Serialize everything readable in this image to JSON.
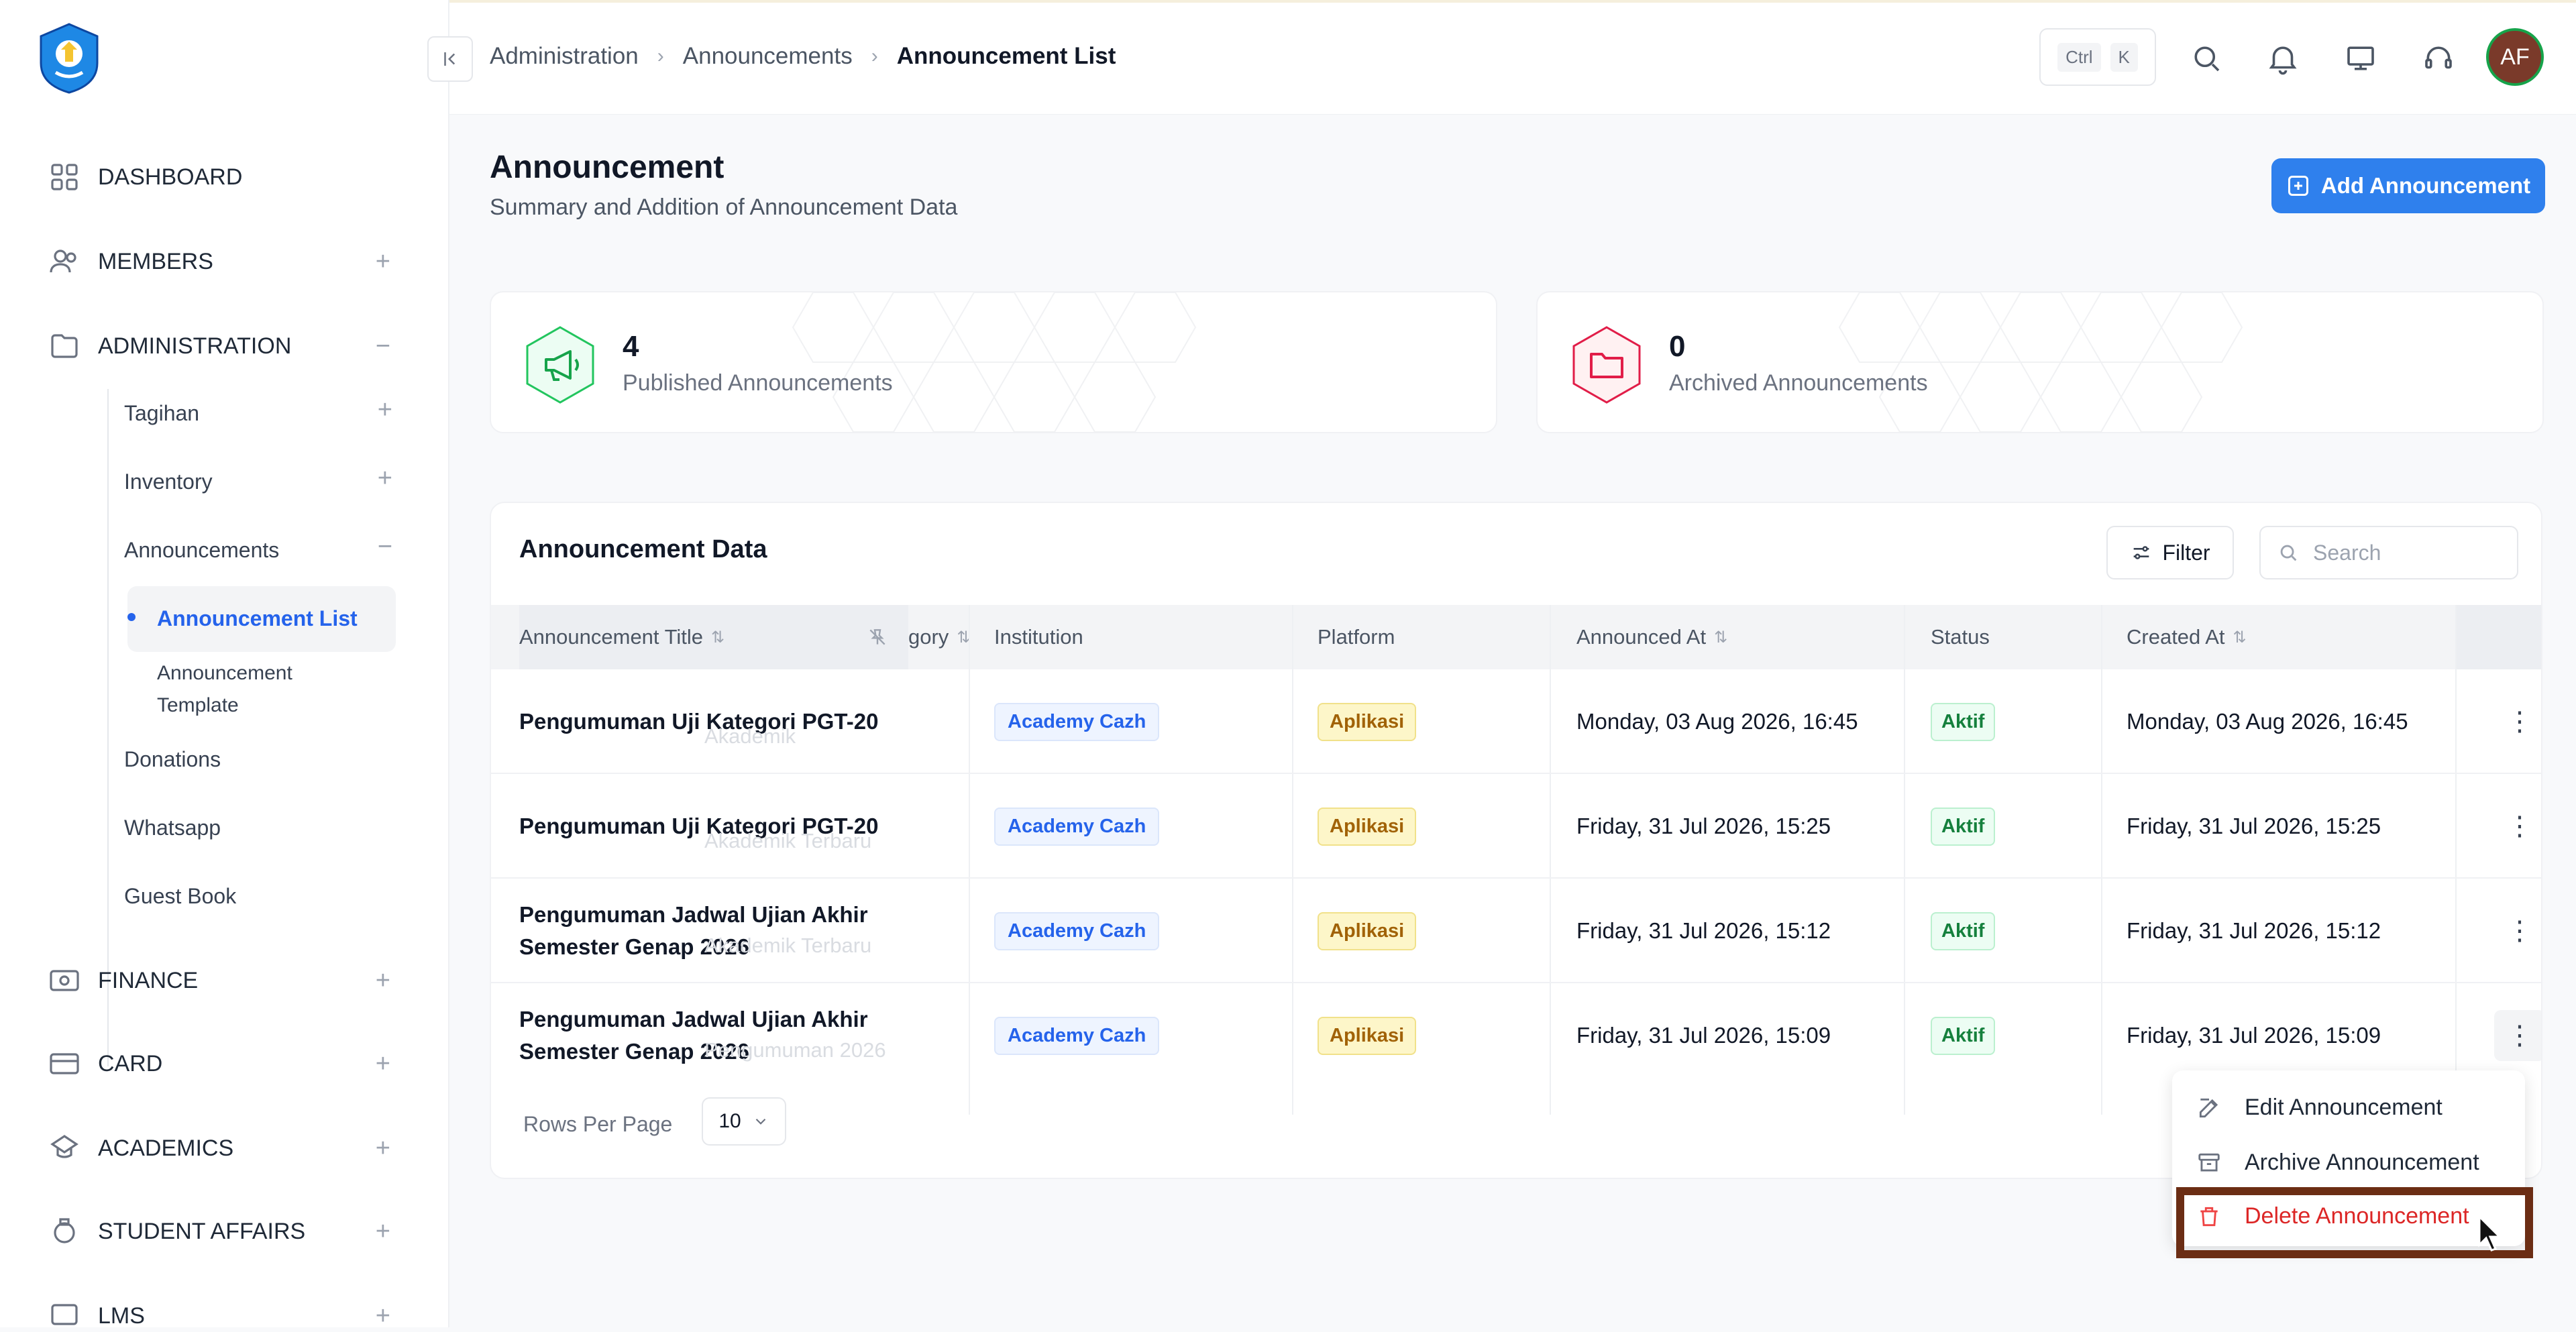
{
  "sidebar": {
    "items": [
      {
        "label": "DASHBOARD",
        "icon": "grid-icon",
        "toggle": ""
      },
      {
        "label": "MEMBERS",
        "icon": "users-icon",
        "toggle": "+"
      },
      {
        "label": "ADMINISTRATION",
        "icon": "folder-icon",
        "toggle": "−"
      },
      {
        "label": "FINANCE",
        "icon": "cash-icon",
        "toggle": "+"
      },
      {
        "label": "CARD",
        "icon": "card-icon",
        "toggle": "+"
      },
      {
        "label": "ACADEMICS",
        "icon": "academics-icon",
        "toggle": "+"
      },
      {
        "label": "STUDENT AFFAIRS",
        "icon": "badge-icon",
        "toggle": "+"
      },
      {
        "label": "LMS",
        "icon": "lms-icon",
        "toggle": "+"
      }
    ],
    "admin_sub": [
      {
        "label": "Tagihan",
        "toggle": "+"
      },
      {
        "label": "Inventory",
        "toggle": "+"
      },
      {
        "label": "Announcements",
        "toggle": "−"
      },
      {
        "label": "Donations",
        "toggle": ""
      },
      {
        "label": "Whatsapp",
        "toggle": ""
      },
      {
        "label": "Guest Book",
        "toggle": ""
      }
    ],
    "ann_sub": [
      {
        "label": "Announcement List",
        "active": true
      },
      {
        "label": "Announcement Template",
        "active": false
      }
    ]
  },
  "header": {
    "breadcrumb": [
      "Administration",
      "Announcements",
      "Announcement List"
    ],
    "kbd": [
      "Ctrl",
      "K"
    ],
    "avatar": "AF"
  },
  "page": {
    "title": "Announcement",
    "subtitle": "Summary and Addition of Announcement Data",
    "add_button": "Add Announcement"
  },
  "stats": [
    {
      "value": "4",
      "label": "Published Announcements",
      "color": "#22c55e"
    },
    {
      "value": "0",
      "label": "Archived Announcements",
      "color": "#e11d48"
    }
  ],
  "table": {
    "heading": "Announcement Data",
    "filter_label": "Filter",
    "search_placeholder": "Search",
    "columns": [
      "Announcement Title",
      "Institution",
      "Platform",
      "Announced At",
      "Status",
      "Created At"
    ],
    "ghost_header": "gory",
    "rows": [
      {
        "title": "Pengumuman Uji Kategori PGT-20",
        "ghost": "Akademik",
        "institution": "Academy Cazh",
        "platform": "Aplikasi",
        "announced": "Monday, 03 Aug 2026, 16:45",
        "status": "Aktif",
        "created": "Monday, 03 Aug 2026, 16:45"
      },
      {
        "title": "Pengumuman Uji Kategori PGT-20",
        "ghost": "Akademik Terbaru",
        "institution": "Academy Cazh",
        "platform": "Aplikasi",
        "announced": "Friday, 31 Jul 2026, 15:25",
        "status": "Aktif",
        "created": "Friday, 31 Jul 2026, 15:25"
      },
      {
        "title": "Pengumuman Jadwal Ujian Akhir Semester Genap 2026",
        "ghost": "Akademik Terbaru",
        "institution": "Academy Cazh",
        "platform": "Aplikasi",
        "announced": "Friday, 31 Jul 2026, 15:12",
        "status": "Aktif",
        "created": "Friday, 31 Jul 2026, 15:12"
      },
      {
        "title": "Pengumuman Jadwal Ujian Akhir Semester Genap 2026",
        "ghost": "Pengumuman 2026",
        "institution": "Academy Cazh",
        "platform": "Aplikasi",
        "announced": "Friday, 31 Jul 2026, 15:09",
        "status": "Aktif",
        "created": "Friday, 31 Jul 2026, 15:09"
      }
    ],
    "rows_per_page_label": "Rows Per Page",
    "rows_per_page_value": "10"
  },
  "context_menu": {
    "items": [
      {
        "label": "Edit Announcement",
        "icon": "edit-icon"
      },
      {
        "label": "Archive Announcement",
        "icon": "archive-icon"
      },
      {
        "label": "Delete Announcement",
        "icon": "trash-icon"
      }
    ]
  },
  "colors": {
    "primary": "#2f80ed",
    "danger": "#dc2626",
    "success": "#15803d",
    "highlight": "#6b2d14"
  }
}
